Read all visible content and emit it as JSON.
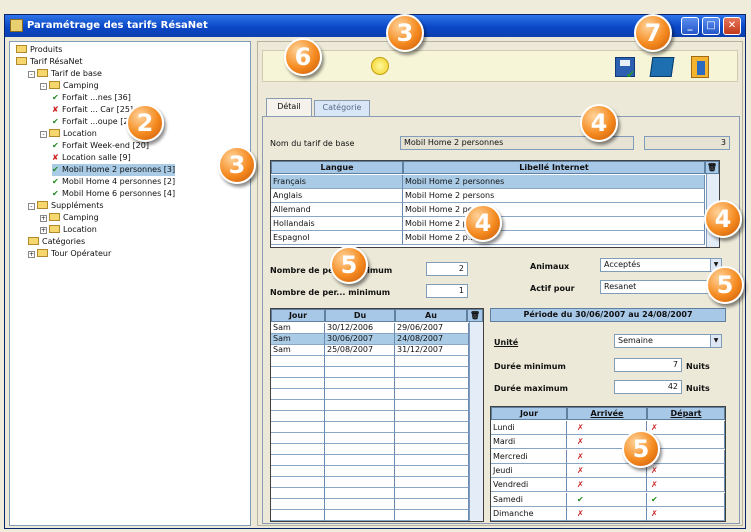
{
  "window": {
    "title": "Paramétrage des tarifs RésaNet"
  },
  "colors": {
    "titlebar": "#0a47c6",
    "badge": "#f58a1f",
    "selection": "#a9cbe6",
    "grid_header": "#a8c8e8"
  },
  "badges": [
    "3",
    "7",
    "6",
    "2",
    "3",
    "4",
    "4",
    "4",
    "5",
    "5",
    "5"
  ],
  "tree": {
    "items": [
      {
        "label": "Produits",
        "icon": "folder-icon"
      },
      {
        "label": "Tarif RésaNet",
        "icon": "folder-icon"
      },
      {
        "label": "Tarif de base",
        "icon": "folder-icon"
      },
      {
        "label": "Camping",
        "icon": "folder-icon"
      },
      {
        "label": "Forfait ...nes [36]",
        "status": "check"
      },
      {
        "label": "Forfait ... Car [25]",
        "status": "cross"
      },
      {
        "label": "Forfait ...oupe [29]",
        "status": "check"
      },
      {
        "label": "Location",
        "icon": "folder-icon"
      },
      {
        "label": "Forfait Week-end [20]",
        "status": "check"
      },
      {
        "label": "Location salle [9]",
        "status": "cross"
      },
      {
        "label": "Mobil Home 2 personnes [3]",
        "status": "check",
        "selected": true
      },
      {
        "label": "Mobil Home 4 personnes [2]",
        "status": "check"
      },
      {
        "label": "Mobil Home 6 personnes [4]",
        "status": "check"
      },
      {
        "label": "Suppléments",
        "icon": "folder-icon"
      },
      {
        "label": "Camping",
        "icon": "folder-icon"
      },
      {
        "label": "Location",
        "icon": "folder-icon"
      },
      {
        "label": "Catégories",
        "icon": "folder-icon"
      },
      {
        "label": "Tour Opérateur",
        "icon": "folder-icon"
      }
    ]
  },
  "toolbar": {
    "icons": [
      "lightbulb-icon",
      "save-icon",
      "book-icon",
      "exit-icon"
    ]
  },
  "tabs": {
    "detail": "Détail",
    "category": "Catégorie"
  },
  "base_name": {
    "label": "Nom du tarif de base",
    "value": "Mobil Home 2 personnes",
    "id": "3"
  },
  "lang_grid": {
    "col_lang": "Langue",
    "col_label": "Libellé Internet",
    "rows": [
      {
        "lang": "Français",
        "label": "Mobil Home 2 personnes"
      },
      {
        "lang": "Anglais",
        "label": "Mobil Home 2 persons"
      },
      {
        "lang": "Allemand",
        "label": "Mobil Home 2 pe..."
      },
      {
        "lang": "Hollandais",
        "label": "Mobil Home 2 p..."
      },
      {
        "lang": "Espagnol",
        "label": "Mobil Home 2 p..."
      }
    ]
  },
  "persons": {
    "max_label": "Nombre de per... maximum",
    "max_value": "2",
    "min_label": "Nombre de per... minimum",
    "min_value": "1"
  },
  "animals": {
    "label": "Animaux",
    "value": "Acceptés"
  },
  "active": {
    "label": "Actif pour",
    "value": "Resanet"
  },
  "period_grid": {
    "col_day": "Jour",
    "col_from": "Du",
    "col_to": "Au",
    "rows": [
      {
        "day": "Sam",
        "from": "30/12/2006",
        "to": "29/06/2007"
      },
      {
        "day": "Sam",
        "from": "30/06/2007",
        "to": "24/08/2007"
      },
      {
        "day": "Sam",
        "from": "25/08/2007",
        "to": "31/12/2007"
      }
    ]
  },
  "period": {
    "title": "Période du 30/06/2007 au 24/08/2007",
    "unit_label": "Unité",
    "unit_value": "Semaine",
    "min_label": "Durée minimum",
    "min_value": "7",
    "min_unit": "Nuits",
    "max_label": "Durée maximum",
    "max_value": "42",
    "max_unit": "Nuits"
  },
  "days_grid": {
    "col_day": "Jour",
    "col_arrival": "Arrivée",
    "col_departure": "Départ",
    "rows": [
      {
        "day": "Lundi",
        "arrival": "✗",
        "departure": "✗"
      },
      {
        "day": "Mardi",
        "arrival": "✗",
        "departure": "✗"
      },
      {
        "day": "Mercredi",
        "arrival": "✗",
        "departure": "✗"
      },
      {
        "day": "Jeudi",
        "arrival": "✗",
        "departure": "✗"
      },
      {
        "day": "Vendredi",
        "arrival": "✗",
        "departure": "✗"
      },
      {
        "day": "Samedi",
        "arrival": "✔",
        "departure": "✔"
      },
      {
        "day": "Dimanche",
        "arrival": "✗",
        "departure": "✗"
      }
    ]
  }
}
